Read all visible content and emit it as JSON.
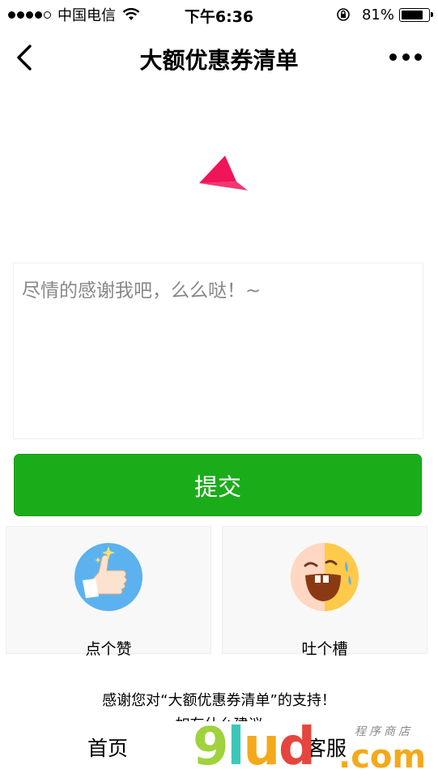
{
  "status_bar": {
    "carrier": "中国电信",
    "time": "下午6:36",
    "battery": "81%",
    "battery_level": 0.81
  },
  "nav": {
    "title": "大额优惠券清单"
  },
  "feedback": {
    "placeholder": "尽情的感谢我吧，么么哒！~"
  },
  "submit_label": "提交",
  "actions": [
    {
      "label": "点个赞"
    },
    {
      "label": "吐个槽"
    }
  ],
  "footer": {
    "thanks": "感谢您对“大额优惠券清单”的支持！",
    "advice": "如有什么建议"
  },
  "tabs": [
    {
      "label": "首页"
    },
    {
      "label": "客服"
    }
  ],
  "watermark": {
    "g": "9",
    "l": "l",
    "u": "u",
    "d": "d",
    "com": ".com",
    "tag": "程序商店"
  },
  "colors": {
    "accent": "#1aad19",
    "logo": "#f0145a"
  }
}
